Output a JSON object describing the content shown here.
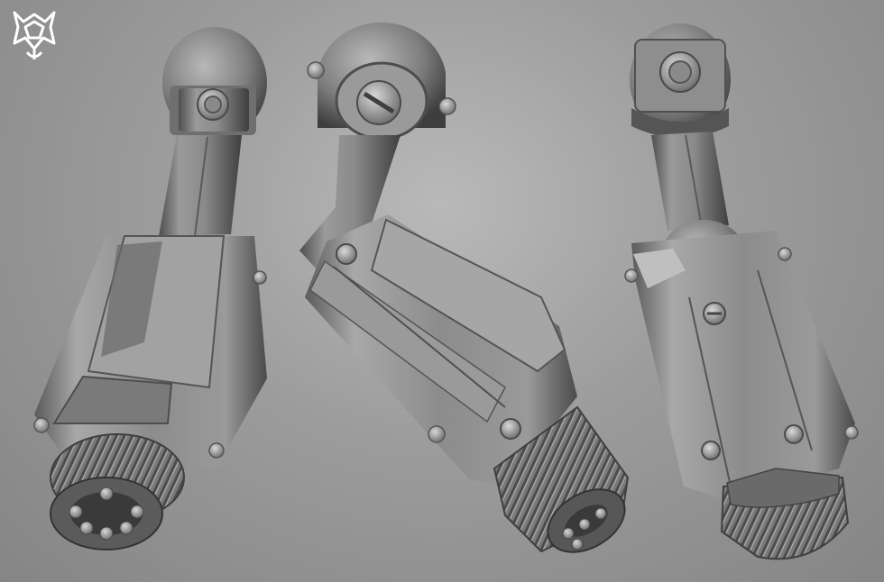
{
  "scene": {
    "background": "#a3a3a3",
    "material": "#8e8e8e",
    "material_shadow": "#4a4a4a",
    "material_highlight": "#d4d4d4",
    "views": [
      {
        "id": "view-1",
        "icon": "robotic-arm"
      },
      {
        "id": "view-2",
        "icon": "robotic-arm"
      },
      {
        "id": "view-3",
        "icon": "robotic-arm"
      }
    ]
  },
  "logo": {
    "icon": "artist-emblem-icon",
    "color": "#ffffff"
  }
}
